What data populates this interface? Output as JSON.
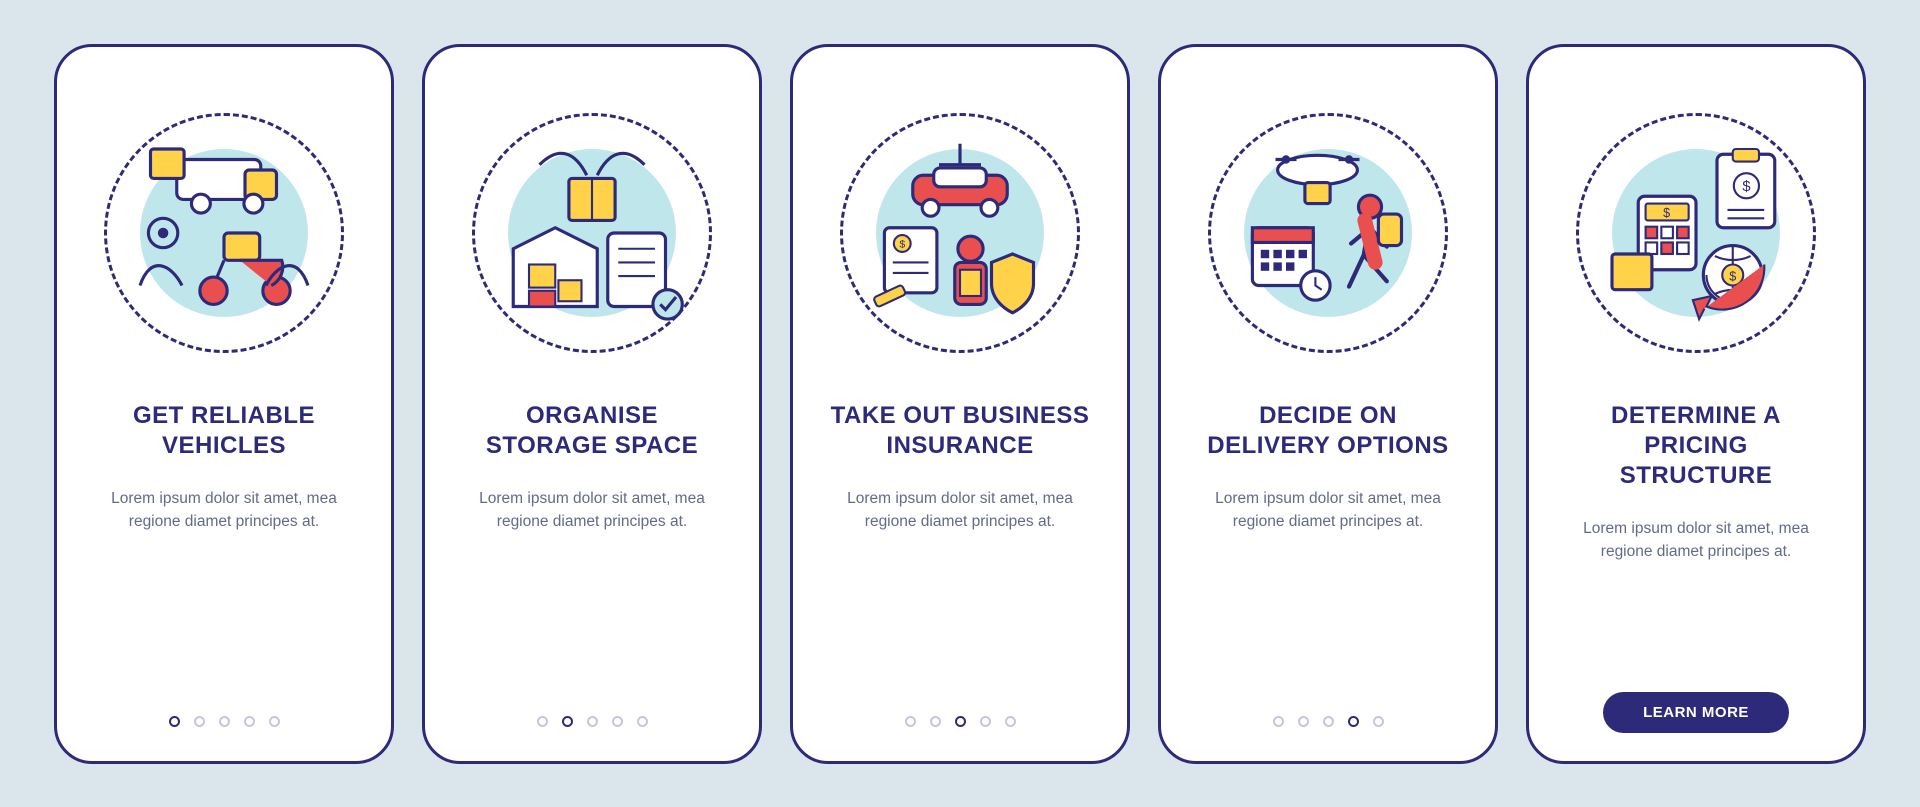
{
  "colors": {
    "primary": "#2e2a7a",
    "accentRed": "#e94f4f",
    "accentYellow": "#ffd24a",
    "accentTeal": "#bfe6ea",
    "pageBg": "#dbe6ec"
  },
  "lorem": "Lorem ipsum dolor sit amet, mea regione diamet principes at.",
  "screens": [
    {
      "title": "Get Reliable Vehicles",
      "icon": "vehicles-icon",
      "active_dot": 0
    },
    {
      "title": "Organise Storage Space",
      "icon": "storage-icon",
      "active_dot": 1
    },
    {
      "title": "Take Out Business Insurance",
      "icon": "insurance-icon",
      "active_dot": 2
    },
    {
      "title": "Decide on Delivery Options",
      "icon": "delivery-icon",
      "active_dot": 3
    },
    {
      "title": "Determine a Pricing Structure",
      "icon": "pricing-icon",
      "active_dot": 4,
      "cta": "LEARN MORE"
    }
  ],
  "dot_count": 5
}
